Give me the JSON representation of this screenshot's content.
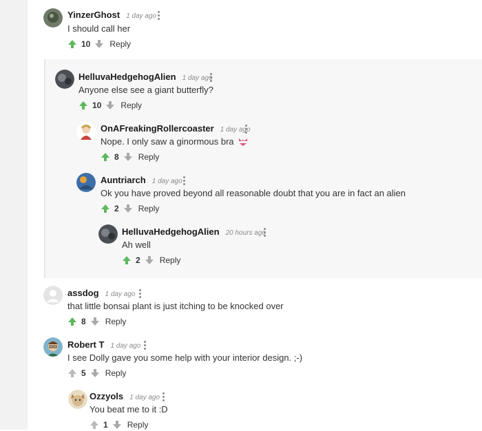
{
  "colors": {
    "upvote_active": "#5cb85c",
    "upvote_inactive": "#b9b9b9",
    "downvote": "#a9a9a9",
    "thread_bg": "#f7f7f7"
  },
  "comments": [
    {
      "user": "YinzerGhost",
      "time": "1 day ago",
      "text": "I should call her",
      "votes": "10",
      "reply": "Reply"
    },
    {
      "user": "HelluvaHedgehogAlien",
      "time": "1 day ago",
      "text": "Anyone else see a giant butterfly?",
      "votes": "10",
      "reply": "Reply"
    },
    {
      "user": "OnAFreakingRollercoaster",
      "time": "1 day ago",
      "text": "Nope. I only saw a ginormous bra",
      "votes": "8",
      "reply": "Reply",
      "emoji": "bikini-icon"
    },
    {
      "user": "Auntriarch",
      "time": "1 day ago",
      "text": "Ok you have proved beyond all reasonable doubt that you are in fact an alien",
      "votes": "2",
      "reply": "Reply"
    },
    {
      "user": "HelluvaHedgehogAlien",
      "time": "20 hours ago",
      "text": "Ah well",
      "votes": "2",
      "reply": "Reply"
    },
    {
      "user": "assdog",
      "time": "1 day ago",
      "text": "that little bonsai plant is just itching to be knocked over",
      "votes": "8",
      "reply": "Reply"
    },
    {
      "user": "Robert T",
      "time": "1 day ago",
      "text": "I see Dolly gave you some help with your interior design. ;-)",
      "votes": "5",
      "reply": "Reply"
    },
    {
      "user": "Ozzyols",
      "time": "1 day ago",
      "text": "You beat me to it :D",
      "votes": "1",
      "reply": "Reply"
    }
  ]
}
